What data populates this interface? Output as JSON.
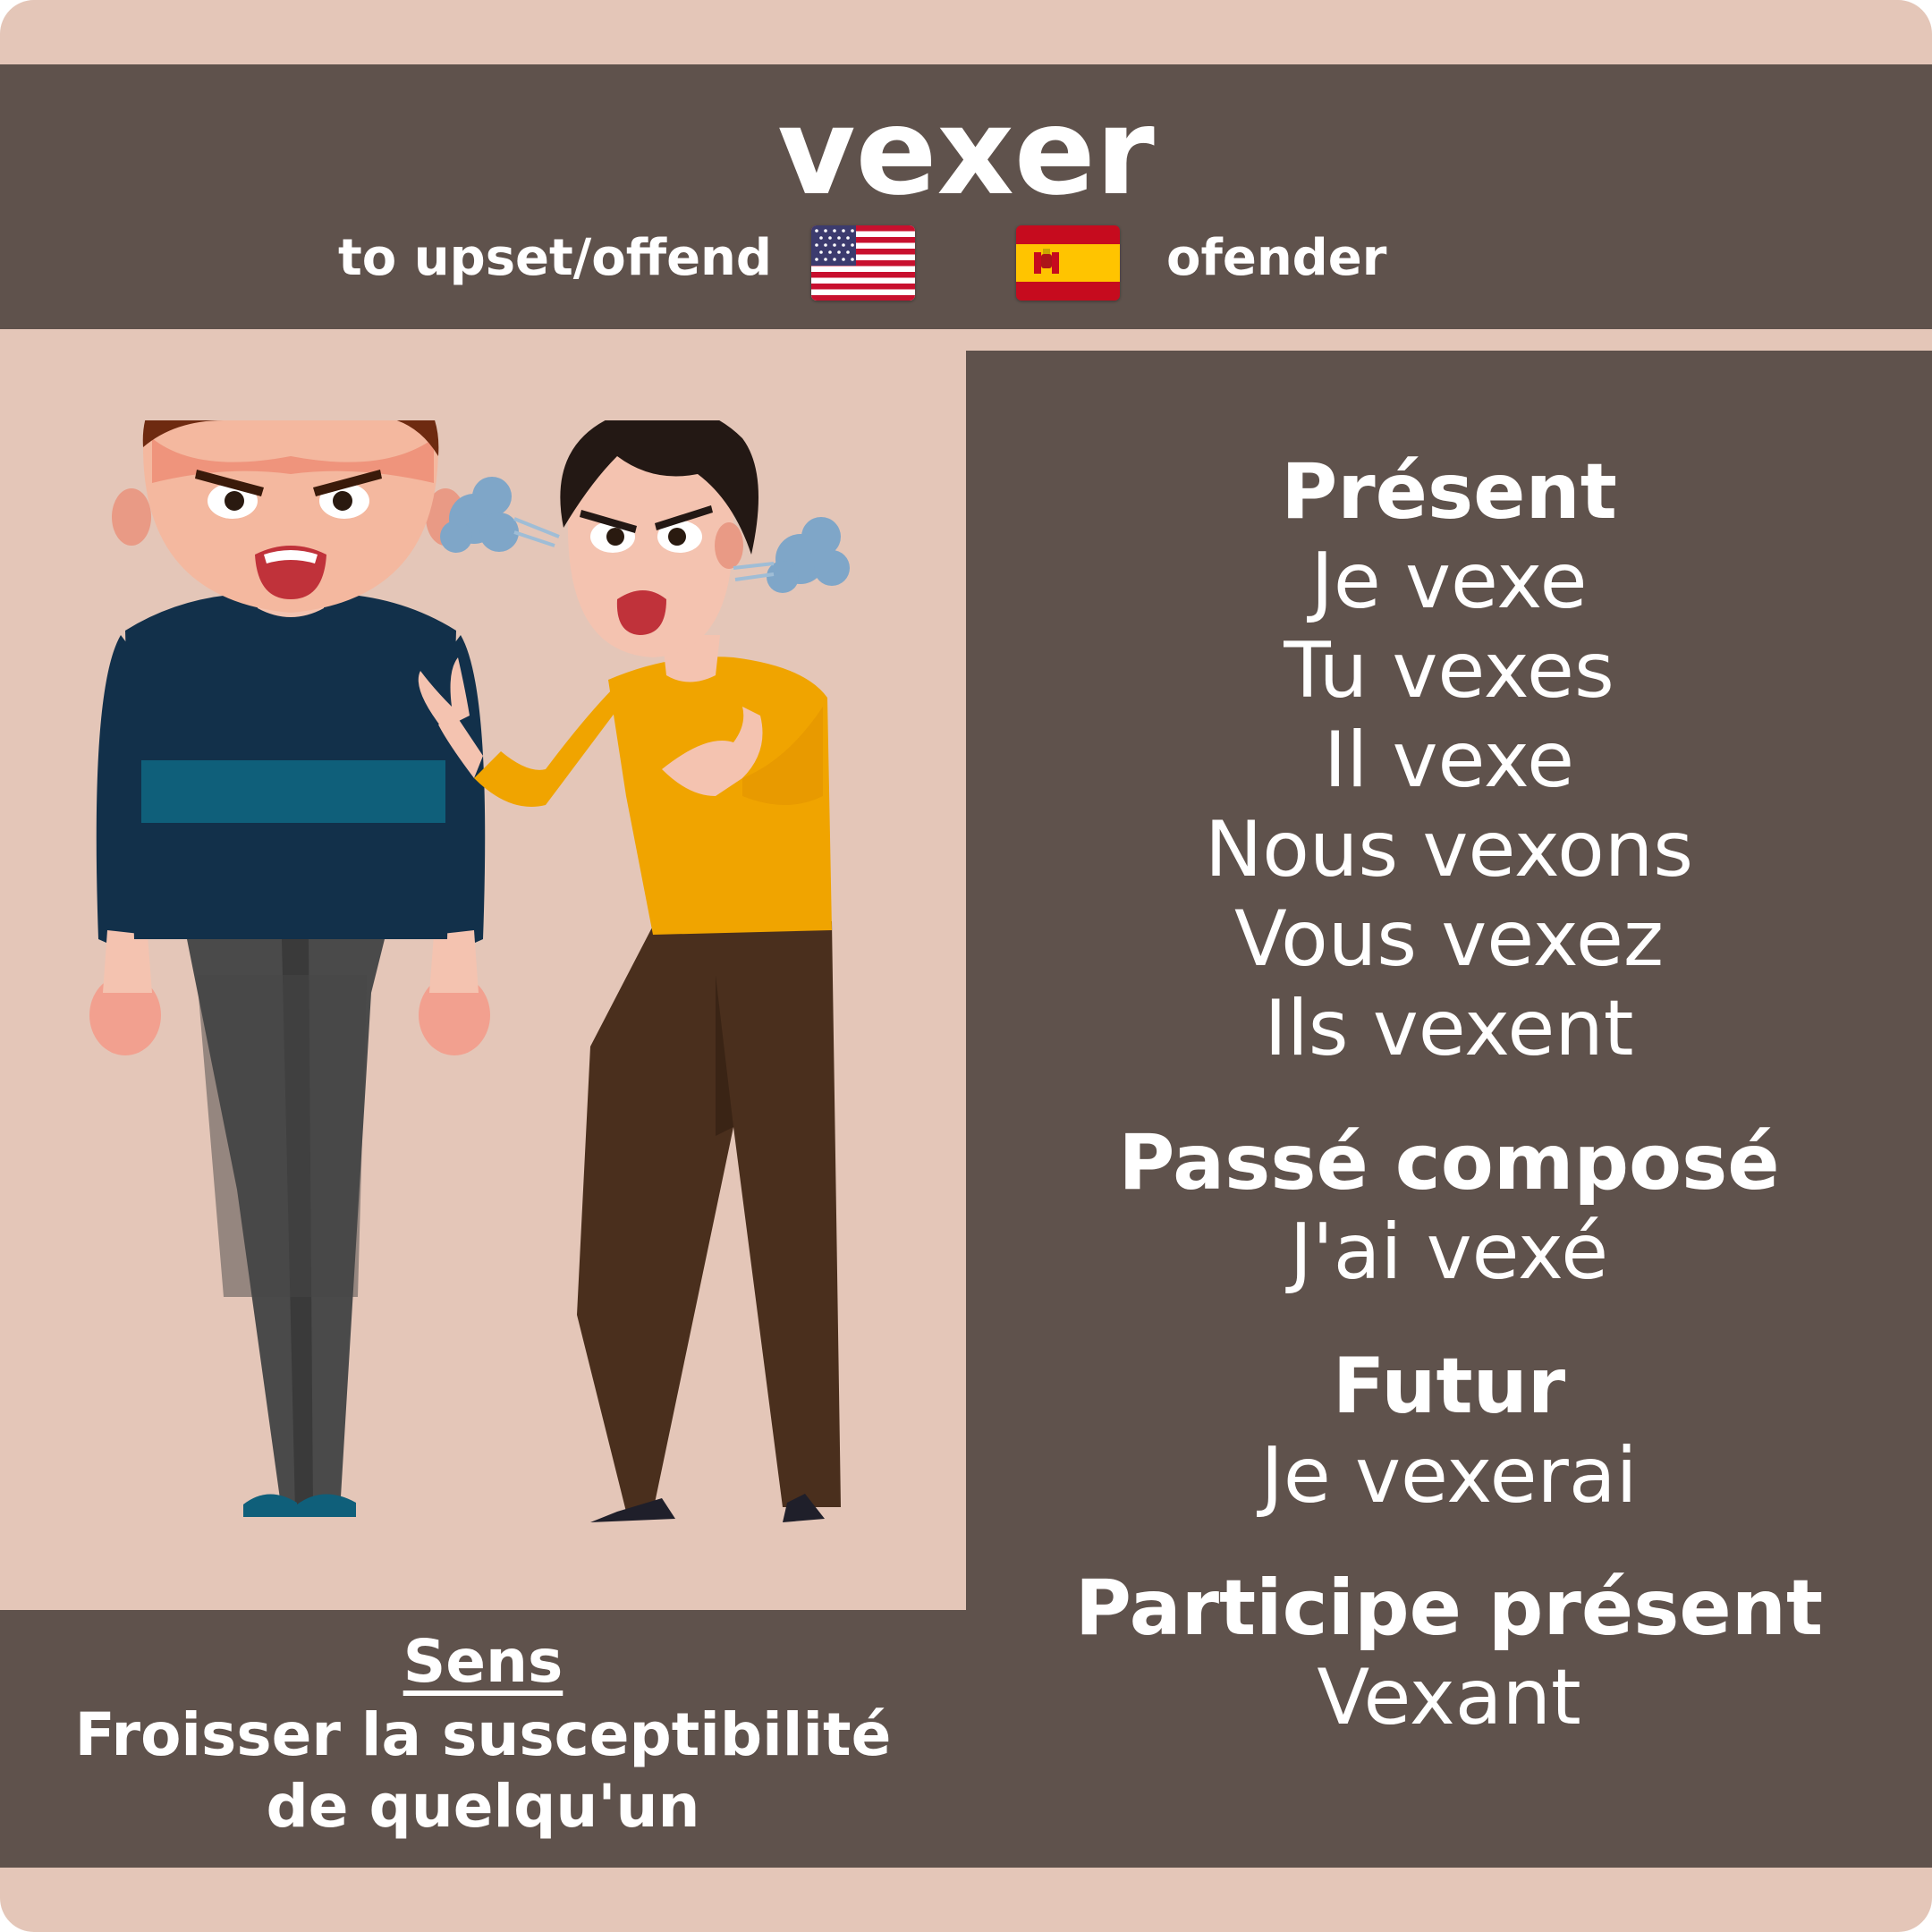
{
  "verb": "vexer",
  "translations": {
    "english": "to upset/offend",
    "english_flag": "us-flag-icon",
    "spanish": "ofender",
    "spanish_flag": "spain-flag-icon"
  },
  "conjugation": {
    "present": {
      "heading": "Présent",
      "forms": [
        "Je vexe",
        "Tu vexes",
        "Il vexe",
        "Nous vexons",
        "Vous vexez",
        "Ils vexent"
      ]
    },
    "passe_compose": {
      "heading": "Passé composé",
      "form": "J'ai vexé"
    },
    "futur": {
      "heading": "Futur",
      "form": "Je vexerai"
    },
    "participe_present": {
      "heading": "Participe présent",
      "form": "Vexant"
    }
  },
  "meaning": {
    "heading": "Sens",
    "lines": [
      "Froisser la susceptibilité",
      "de quelqu'un"
    ]
  },
  "colors": {
    "background": "#e4c6b8",
    "panel": "#5f524c",
    "text": "#ffffff",
    "sweater_navy": "#12304a",
    "sweater_yellow": "#f0a400"
  }
}
